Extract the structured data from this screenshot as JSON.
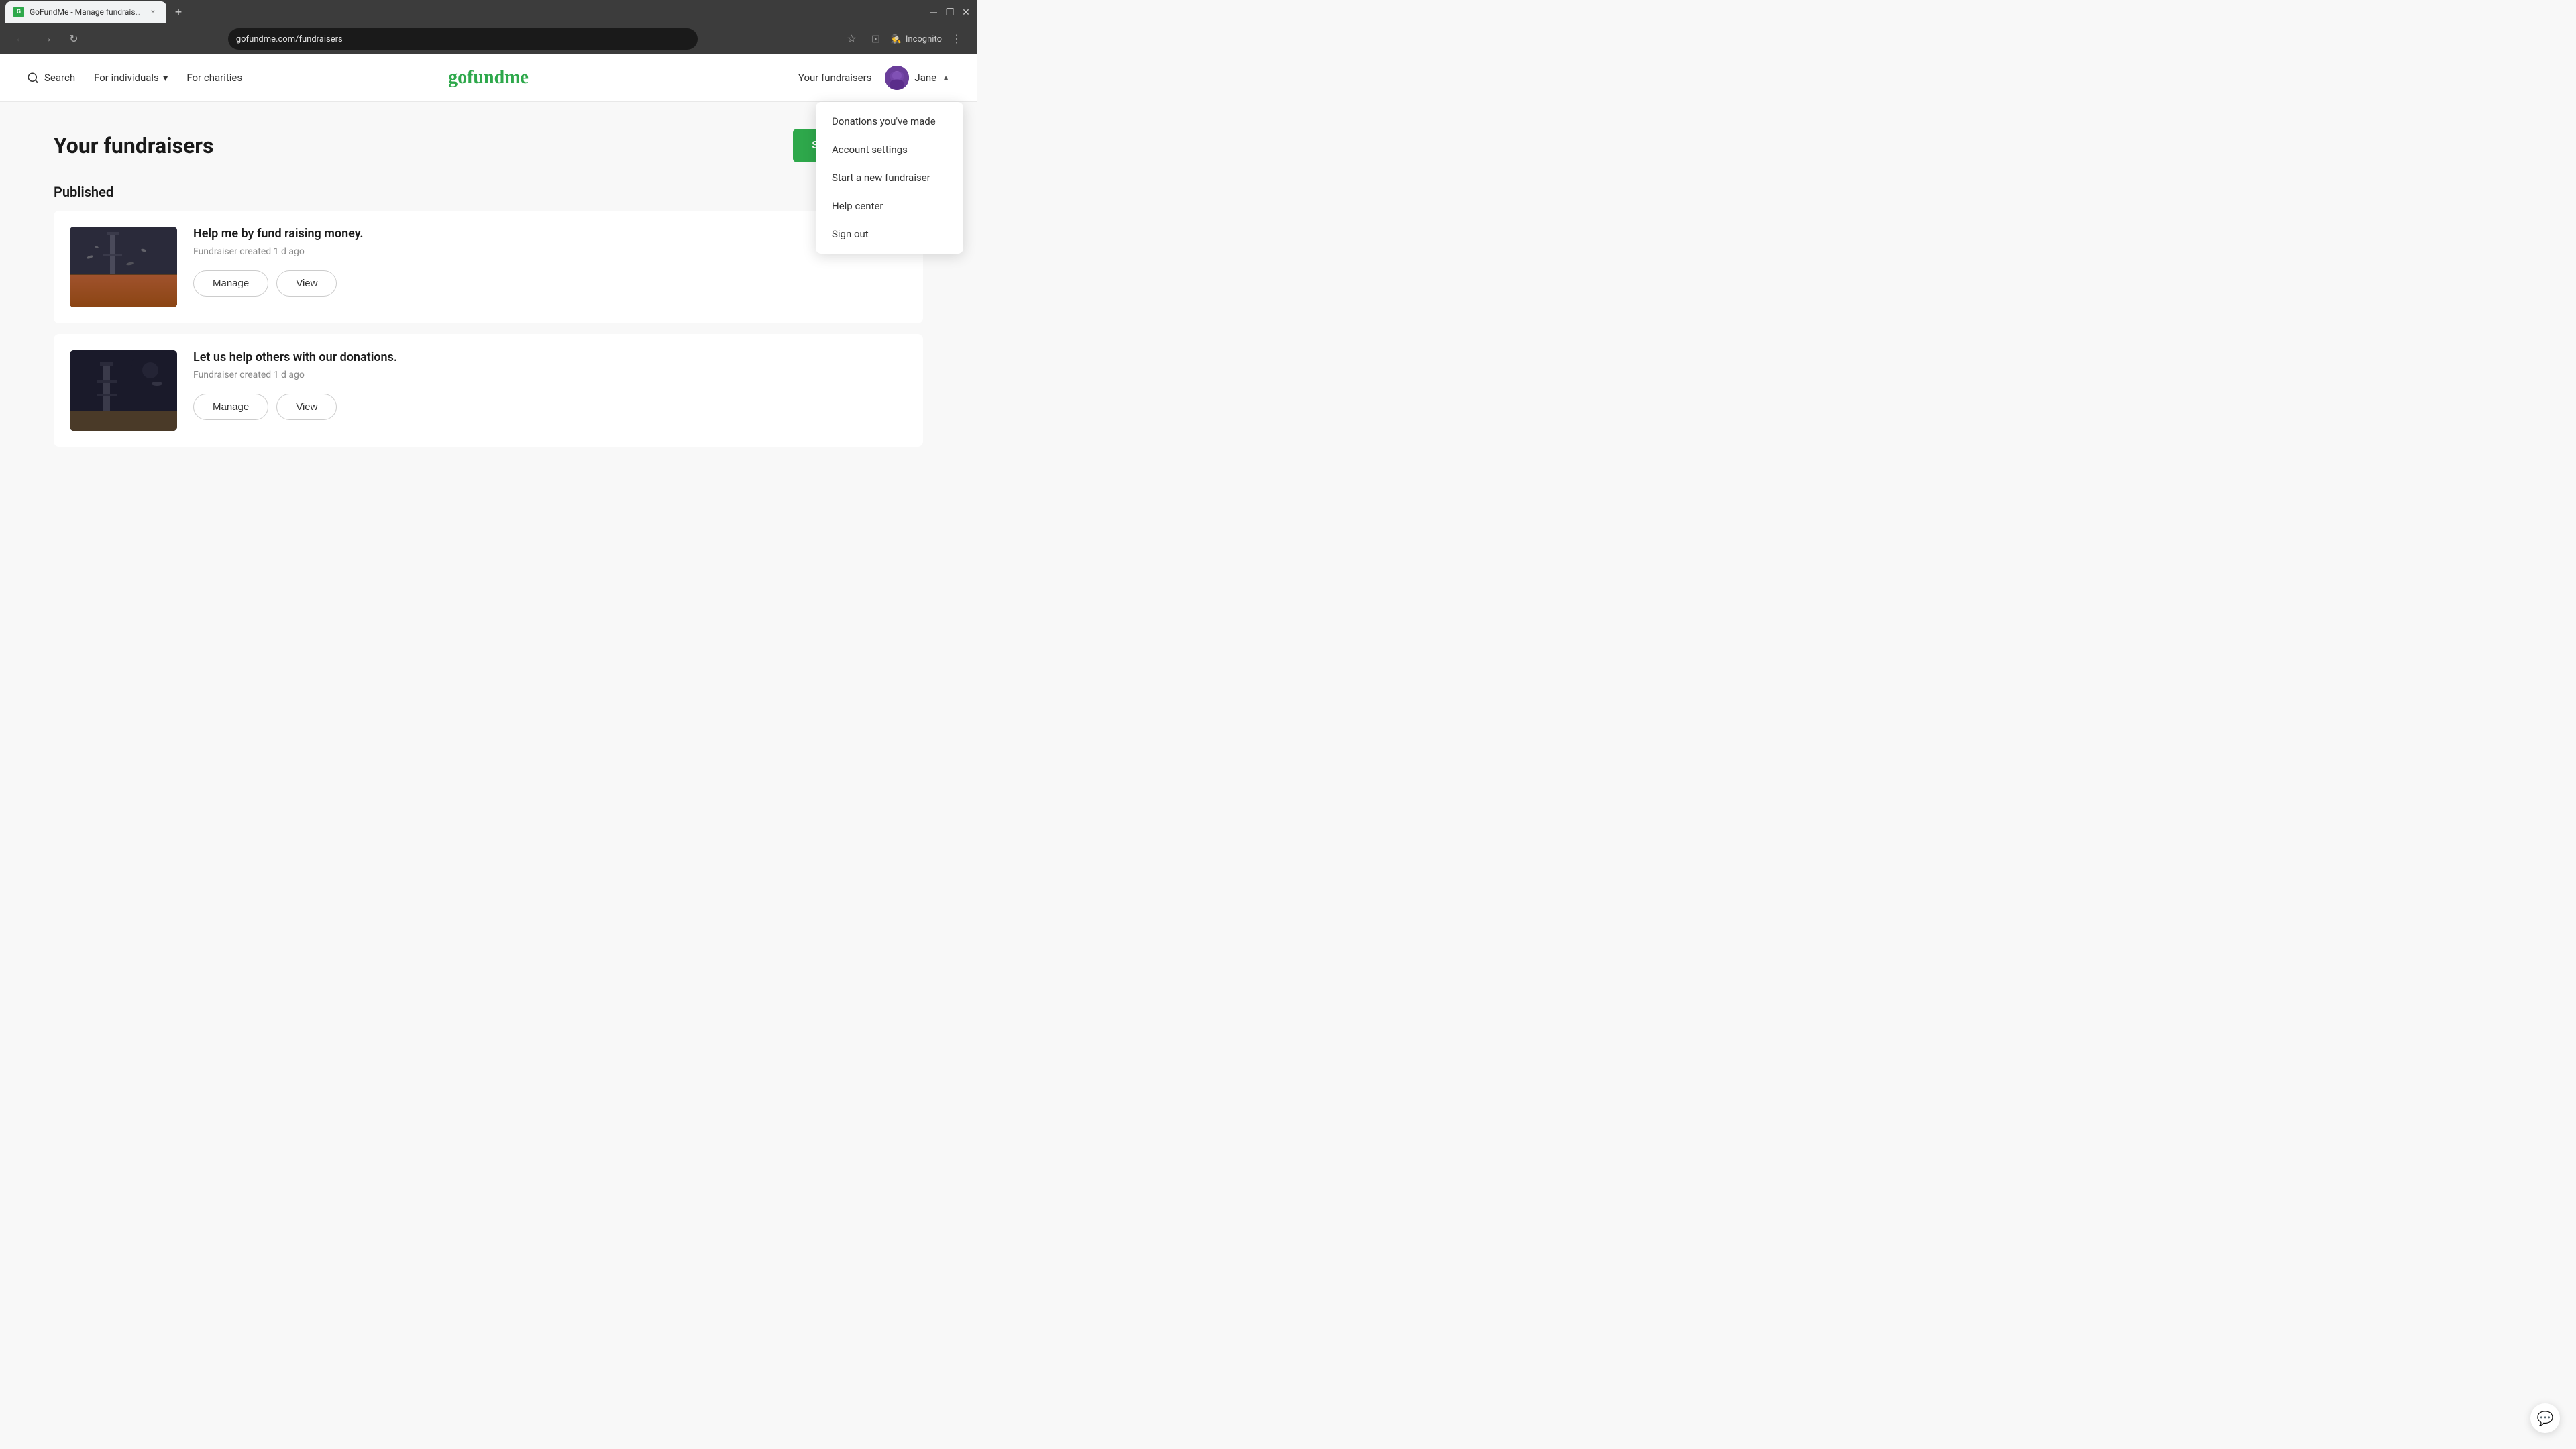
{
  "browser": {
    "tab": {
      "favicon": "G",
      "title": "GoFundMe - Manage fundraise...",
      "close_label": "×"
    },
    "new_tab_label": "+",
    "url": "gofundme.com/fundraisers",
    "incognito_label": "Incognito",
    "nav": {
      "back_label": "←",
      "forward_label": "→",
      "refresh_label": "↻",
      "star_label": "☆",
      "tab_switcher_label": "⊡",
      "menu_label": "⋮"
    }
  },
  "nav": {
    "search_label": "Search",
    "for_individuals_label": "For individuals",
    "for_charities_label": "For charities",
    "logo_text": "gofundme",
    "your_fundraisers_label": "Your fundraisers",
    "user_name": "Jane",
    "chevron": "▲"
  },
  "dropdown": {
    "items": [
      {
        "id": "donations",
        "label": "Donations you've made"
      },
      {
        "id": "account",
        "label": "Account settings"
      },
      {
        "id": "new-fundraiser",
        "label": "Start a new fundraiser"
      },
      {
        "id": "help",
        "label": "Help center"
      },
      {
        "id": "signout",
        "label": "Sign out"
      }
    ]
  },
  "main": {
    "title": "Your fundraisers",
    "start_button_label": "Start a GoFundMe",
    "published_label": "Published",
    "fundraisers": [
      {
        "id": 1,
        "name": "Help me by fund raising money.",
        "meta": "Fundraiser created 1 d ago",
        "manage_label": "Manage",
        "view_label": "View"
      },
      {
        "id": 2,
        "name": "Let us help others with our donations.",
        "meta": "Fundraiser created 1 d ago",
        "manage_label": "Manage",
        "view_label": "View"
      }
    ]
  },
  "colors": {
    "brand_green": "#2ea84b",
    "text_dark": "#1a1a1a",
    "text_muted": "#888888"
  }
}
